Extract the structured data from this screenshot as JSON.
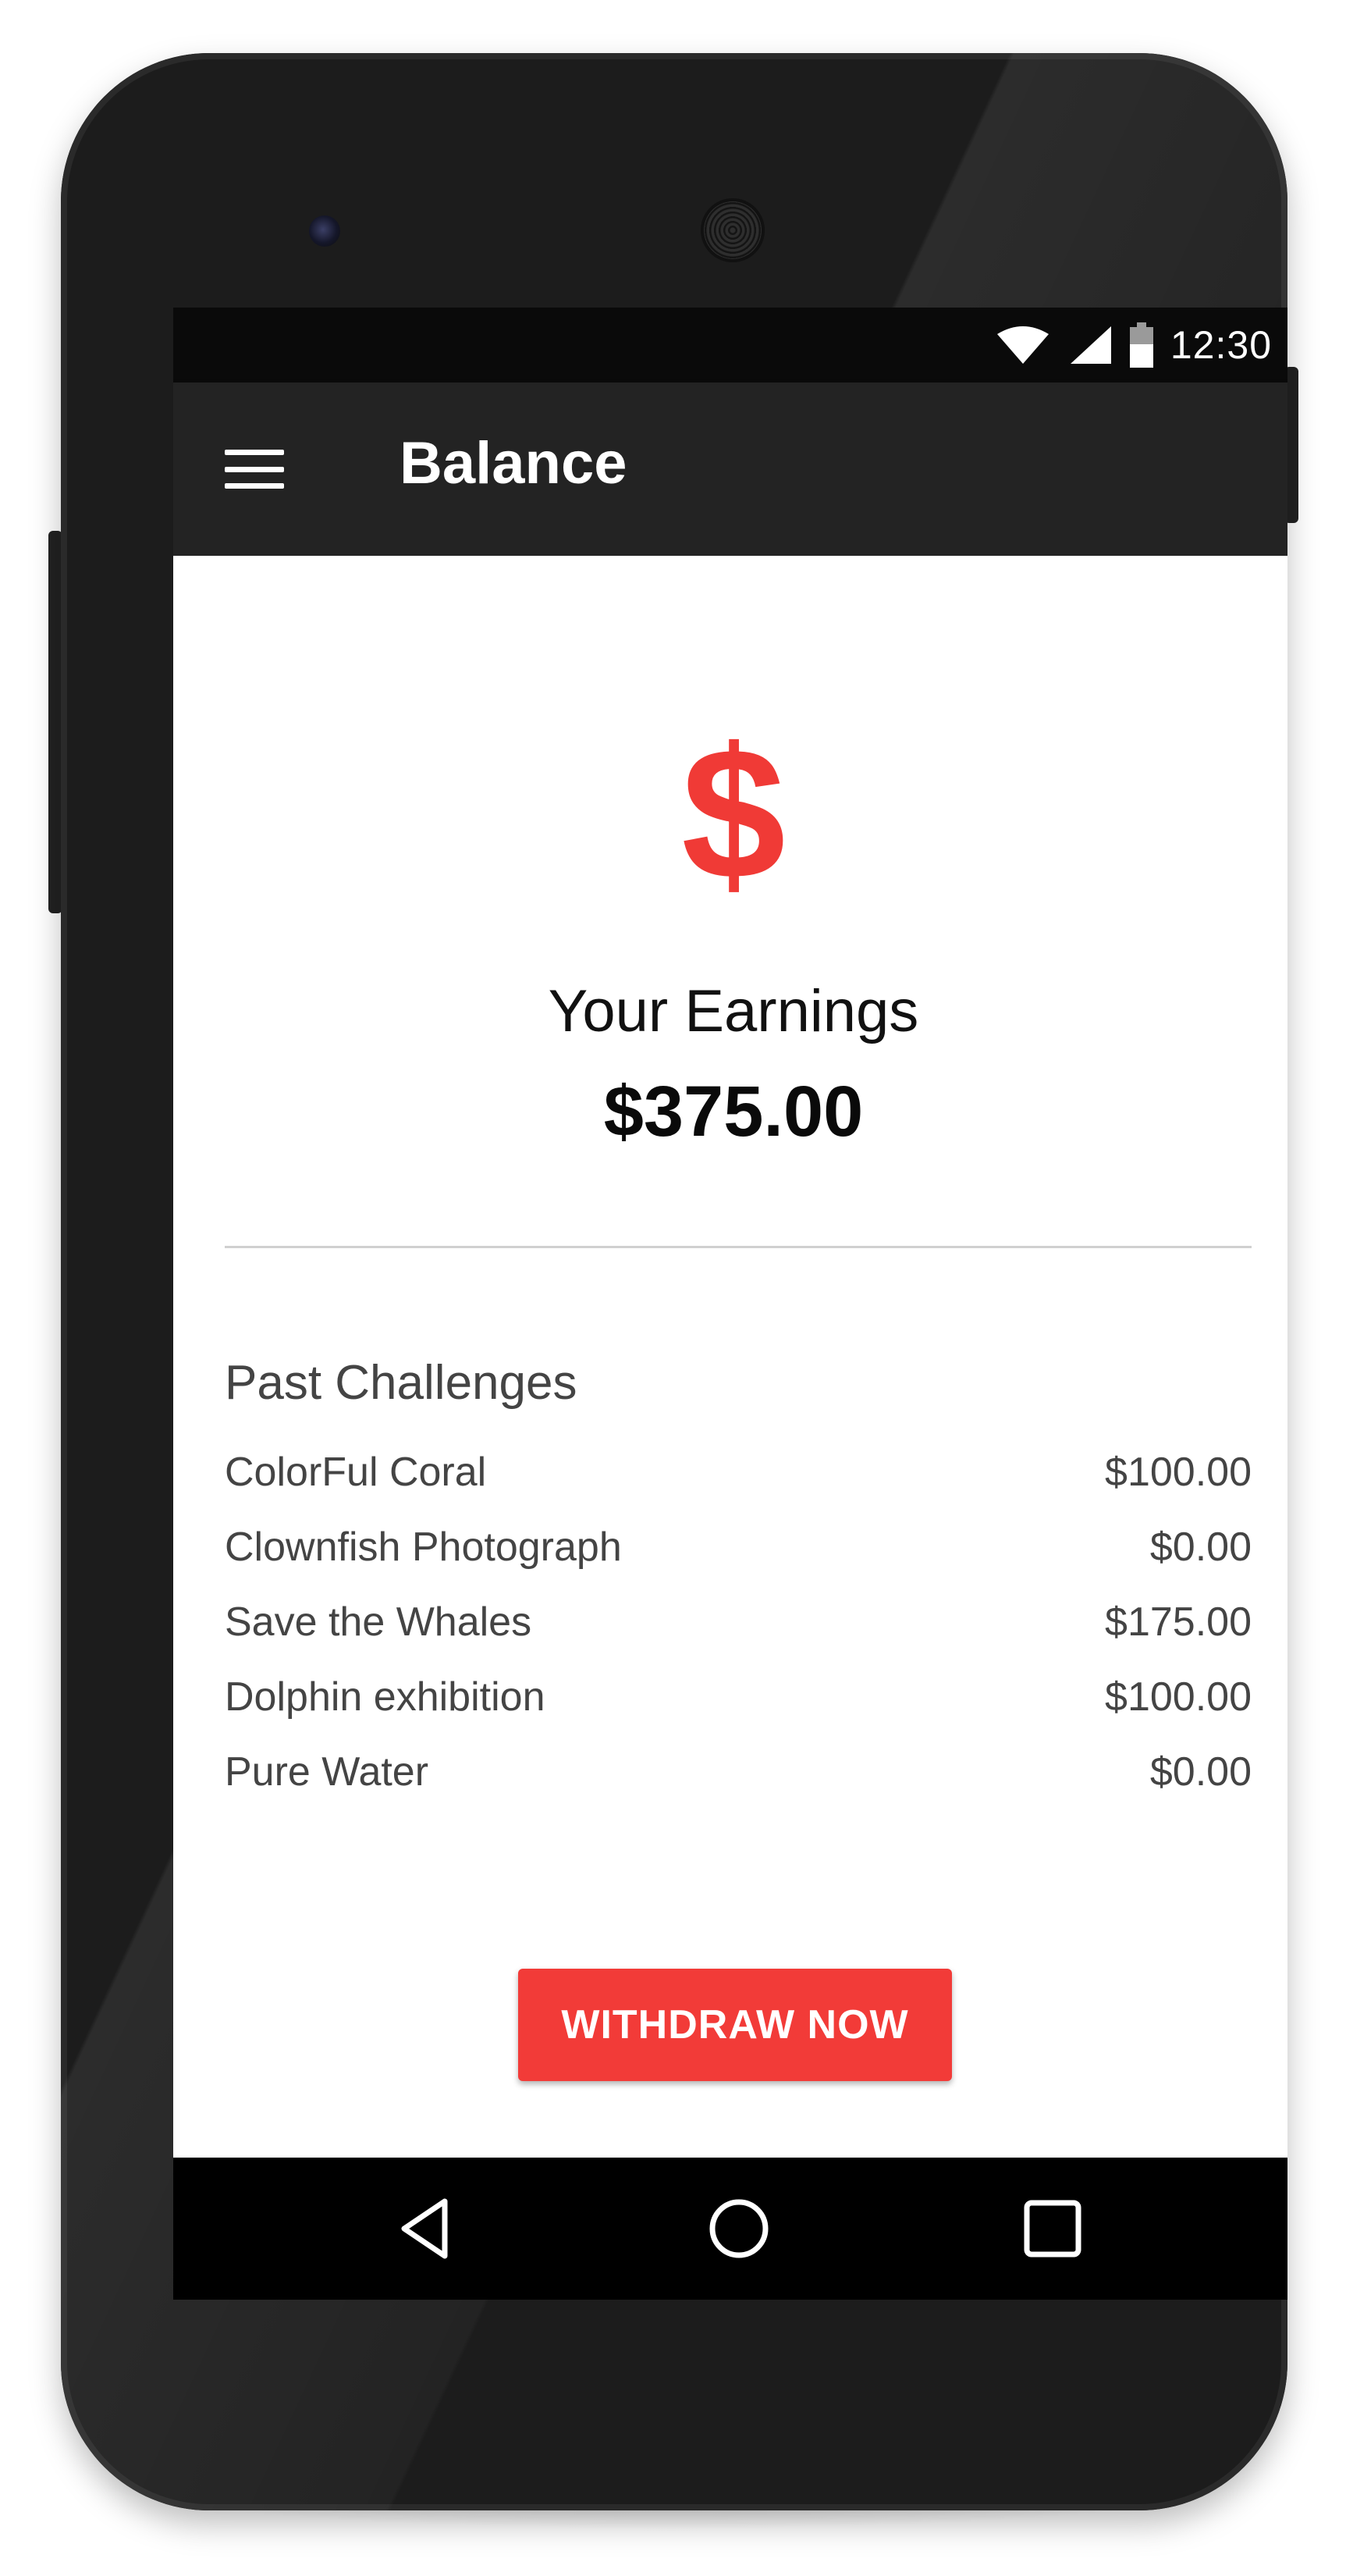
{
  "status_bar": {
    "time": "12:30",
    "icons": [
      "wifi-icon",
      "signal-icon",
      "battery-icon"
    ]
  },
  "app_bar": {
    "title": "Balance",
    "menu_icon": "hamburger-menu-icon"
  },
  "earnings": {
    "icon": "dollar-icon",
    "icon_glyph": "$",
    "label": "Your Earnings",
    "amount": "$375.00"
  },
  "past_challenges": {
    "title": "Past Challenges",
    "items": [
      {
        "name": "ColorFul Coral",
        "amount": "$100.00"
      },
      {
        "name": "Clownfish Photograph",
        "amount": "$0.00"
      },
      {
        "name": "Save the Whales",
        "amount": "$175.00"
      },
      {
        "name": "Dolphin exhibition",
        "amount": "$100.00"
      },
      {
        "name": "Pure Water",
        "amount": "$0.00"
      }
    ]
  },
  "actions": {
    "withdraw_label": "WITHDRAW NOW"
  },
  "nav_bar": {
    "buttons": [
      "back-icon",
      "home-icon",
      "recent-apps-icon"
    ]
  },
  "colors": {
    "accent": "#f23b38",
    "app_bar": "#232323",
    "status_bar": "#0a0a0a",
    "nav_bar": "#000000",
    "text_primary": "#111111",
    "text_secondary": "#444444"
  }
}
